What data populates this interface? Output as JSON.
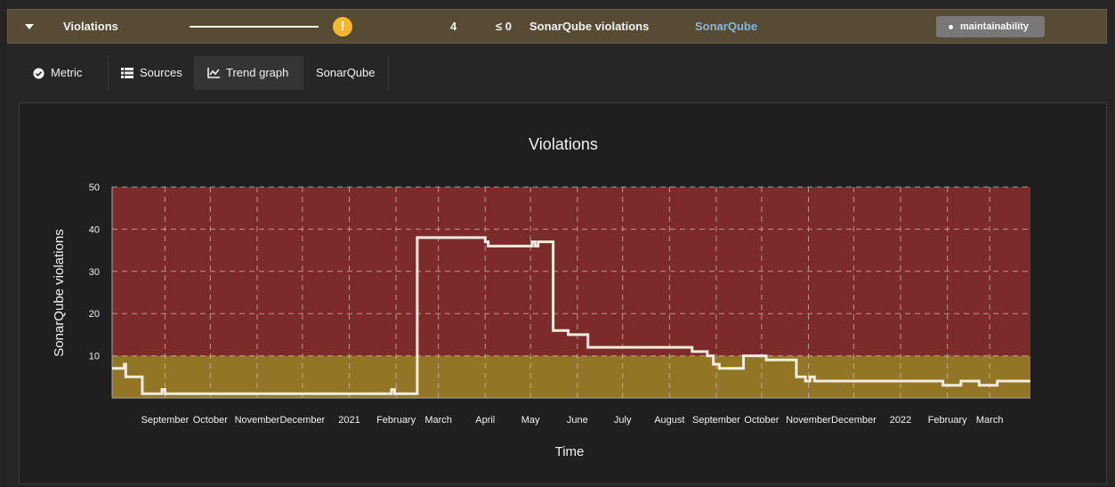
{
  "metric_row": {
    "name": "Violations",
    "status_symbol": "!",
    "status_color": "#f5b82c",
    "value": "4",
    "target": "≤ 0",
    "unit": "SonarQube violations",
    "source": "SonarQube",
    "tag": "maintainability",
    "caret_icon": "caret-down-icon"
  },
  "tabs": [
    {
      "label": "Metric",
      "icon": "check-circle-icon"
    },
    {
      "label": "Sources",
      "icon": "list-icon"
    },
    {
      "label": "Trend graph",
      "icon": "line-chart-icon",
      "active": true
    },
    {
      "label": "SonarQube",
      "icon": ""
    }
  ],
  "chart_data": {
    "type": "line",
    "title": "Violations",
    "xlabel": "Time",
    "ylabel": "SonarQube violations",
    "ylim": [
      0,
      50
    ],
    "yticks": [
      10,
      20,
      30,
      40,
      50
    ],
    "grid": true,
    "xrange": [
      "2020-07-28",
      "2022-03-28"
    ],
    "xticks": [
      {
        "date": "2020-09-01",
        "label": "September"
      },
      {
        "date": "2020-10-01",
        "label": "October"
      },
      {
        "date": "2020-11-01",
        "label": "November"
      },
      {
        "date": "2020-12-01",
        "label": "December"
      },
      {
        "date": "2021-01-01",
        "label": "2021"
      },
      {
        "date": "2021-02-01",
        "label": "February"
      },
      {
        "date": "2021-03-01",
        "label": "March"
      },
      {
        "date": "2021-04-01",
        "label": "April"
      },
      {
        "date": "2021-05-01",
        "label": "May"
      },
      {
        "date": "2021-06-01",
        "label": "June"
      },
      {
        "date": "2021-07-01",
        "label": "July"
      },
      {
        "date": "2021-08-01",
        "label": "August"
      },
      {
        "date": "2021-09-01",
        "label": "September"
      },
      {
        "date": "2021-10-01",
        "label": "October"
      },
      {
        "date": "2021-11-01",
        "label": "November"
      },
      {
        "date": "2021-12-01",
        "label": "December"
      },
      {
        "date": "2022-01-01",
        "label": "2022"
      },
      {
        "date": "2022-02-01",
        "label": "February"
      },
      {
        "date": "2022-03-01",
        "label": "March"
      }
    ],
    "bands": [
      {
        "from": 0,
        "to": 10,
        "color": "#937526"
      },
      {
        "from": 10,
        "to": 50,
        "color": "#7d2a2a"
      }
    ],
    "series": [
      {
        "color": "#f2ecdf",
        "step": true,
        "points": [
          {
            "x": "2020-07-28",
            "y": 7
          },
          {
            "x": "2020-08-05",
            "y": 8
          },
          {
            "x": "2020-08-06",
            "y": 5
          },
          {
            "x": "2020-08-16",
            "y": 5
          },
          {
            "x": "2020-08-17",
            "y": 1
          },
          {
            "x": "2020-08-30",
            "y": 2
          },
          {
            "x": "2020-09-01",
            "y": 1
          },
          {
            "x": "2021-01-29",
            "y": 2
          },
          {
            "x": "2021-01-31",
            "y": 1
          },
          {
            "x": "2021-02-15",
            "y": 38
          },
          {
            "x": "2021-04-01",
            "y": 37
          },
          {
            "x": "2021-04-03",
            "y": 36
          },
          {
            "x": "2021-05-02",
            "y": 37
          },
          {
            "x": "2021-05-04",
            "y": 36
          },
          {
            "x": "2021-05-06",
            "y": 37
          },
          {
            "x": "2021-05-16",
            "y": 16
          },
          {
            "x": "2021-05-26",
            "y": 15
          },
          {
            "x": "2021-06-08",
            "y": 12
          },
          {
            "x": "2021-08-16",
            "y": 11
          },
          {
            "x": "2021-08-26",
            "y": 10
          },
          {
            "x": "2021-08-30",
            "y": 8
          },
          {
            "x": "2021-09-03",
            "y": 7
          },
          {
            "x": "2021-09-19",
            "y": 10
          },
          {
            "x": "2021-10-04",
            "y": 9
          },
          {
            "x": "2021-10-24",
            "y": 5
          },
          {
            "x": "2021-10-30",
            "y": 4
          },
          {
            "x": "2021-11-02",
            "y": 5
          },
          {
            "x": "2021-11-05",
            "y": 4
          },
          {
            "x": "2022-01-29",
            "y": 3
          },
          {
            "x": "2022-02-10",
            "y": 4
          },
          {
            "x": "2022-02-22",
            "y": 3
          },
          {
            "x": "2022-03-06",
            "y": 4
          },
          {
            "x": "2022-03-28",
            "y": 4
          }
        ]
      }
    ]
  }
}
